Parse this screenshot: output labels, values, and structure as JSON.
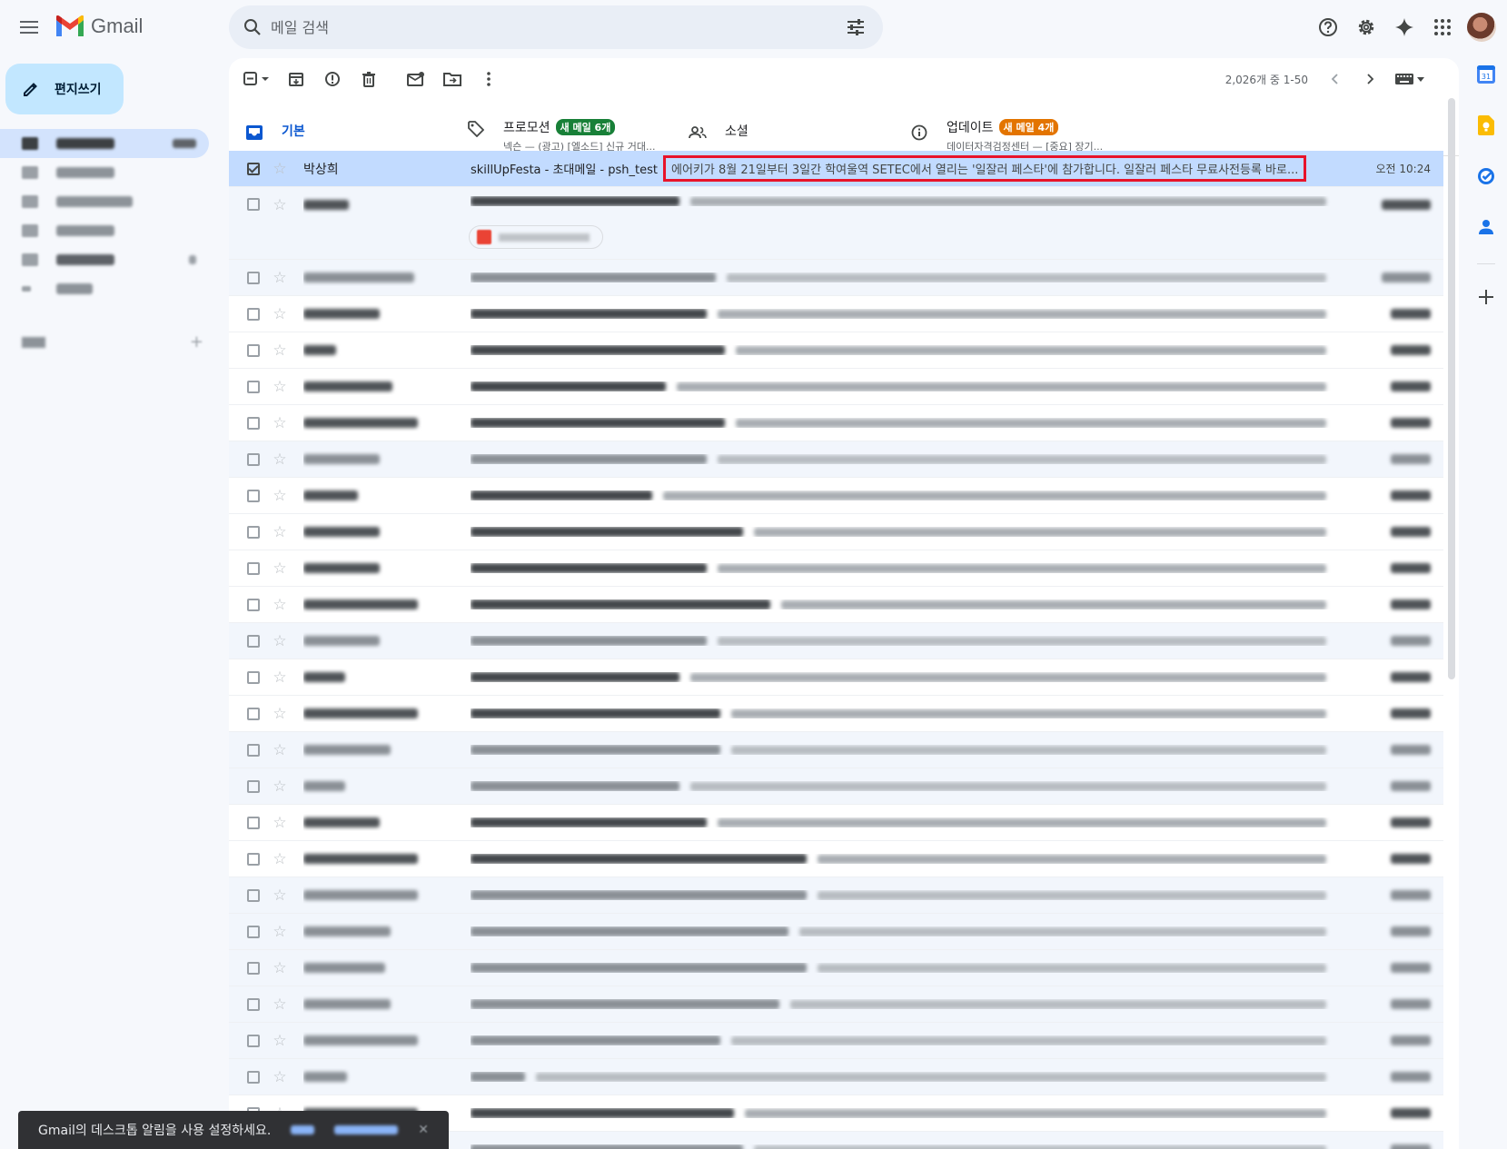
{
  "app": {
    "name": "Gmail"
  },
  "search": {
    "placeholder": "메일 검색"
  },
  "compose": {
    "label": "편지쓰기"
  },
  "pager": {
    "text": "2,026개 중 1-50"
  },
  "tabs": [
    {
      "label": "기본"
    },
    {
      "label": "프로모션",
      "badge": "새 메일 6개",
      "subtitle": "넥슨 — (광고) [엘소드] 신규 거대..."
    },
    {
      "label": "소셜"
    },
    {
      "label": "업데이트",
      "badge": "새 메일 4개",
      "subtitle": "데이터자격검정센터 — [중요] 장기..."
    }
  ],
  "selected_email": {
    "sender": "박상희",
    "subject": "skillUpFesta - 초대메일 - psh_test",
    "snippet": "에어키가 8월 21일부터 3일간 학여울역 SETEC에서 열리는 '일잘러 페스타'에 참가합니다. 일잘러 페스타 무료사전등록 바로...",
    "date": "오전 10:24"
  },
  "snackbar": {
    "text": "Gmail의 데스크톱 알림을 사용 설정하세요."
  },
  "colors": {
    "accent": "#0b57d0",
    "compose_bg": "#c2e7ff",
    "selected_row": "#c2dbff",
    "highlight_border": "#e8132a",
    "promo_badge": "#188038",
    "update_badge": "#e37400"
  }
}
